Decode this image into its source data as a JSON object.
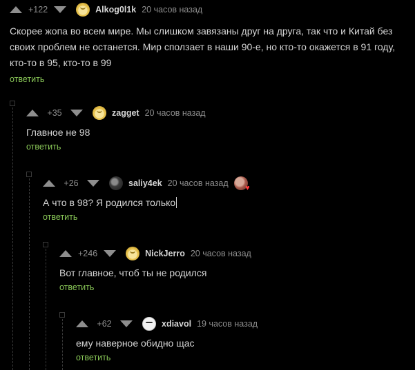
{
  "comments": [
    {
      "rating": "+122",
      "nick": "Alkog0l1k",
      "time": "20 часов назад",
      "text": "Скорее жопа во всем мире. Мы слишком завязаны друг на друга, так что и Китай без своих проблем не останется. Мир сползает в наши 90-е, но кто-то окажется в 91 году, кто-то в 95, кто-то в 99",
      "reply": "ответить"
    },
    {
      "rating": "+35",
      "nick": "zagget",
      "time": "20 часов назад",
      "text": "Главное не 98",
      "reply": "ответить"
    },
    {
      "rating": "+26",
      "nick": "saliy4ek",
      "time": "20 часов назад",
      "text": "А что в 98? Я родился только",
      "reply": "ответить"
    },
    {
      "rating": "+246",
      "nick": "NickJerro",
      "time": "20 часов назад",
      "text": "Вот главное, чтоб ты не родился",
      "reply": "ответить"
    },
    {
      "rating": "+62",
      "nick": "xdiavol",
      "time": "19 часов назад",
      "text": "ему наверное обидно щас",
      "reply": "ответить"
    }
  ],
  "colors": {
    "background": "#000000",
    "text": "#d5d5d5",
    "muted": "#8e8e8e",
    "reply": "#8ac858"
  },
  "icons": {
    "upvote": "triangle-up-icon",
    "downvote": "triangle-down-icon",
    "badge": "heart-badge-icon"
  }
}
